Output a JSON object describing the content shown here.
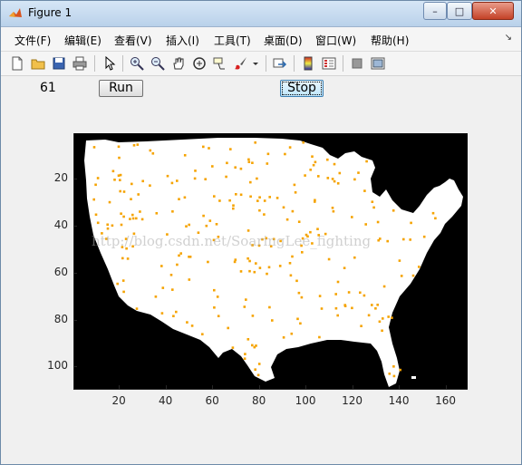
{
  "window": {
    "title": "Figure 1",
    "minimize_glyph": "–",
    "maximize_glyph": "□",
    "close_glyph": "✕"
  },
  "menu": {
    "items": [
      "文件(F)",
      "编辑(E)",
      "查看(V)",
      "插入(I)",
      "工具(T)",
      "桌面(D)",
      "窗口(W)",
      "帮助(H)"
    ],
    "dock_glyph": "↘"
  },
  "toolbar": {
    "icons": [
      "new-figure-icon",
      "open-file-icon",
      "save-icon",
      "print-icon",
      "arrow-pointer-icon",
      "zoom-in-icon",
      "zoom-out-icon",
      "pan-hand-icon",
      "rotate-3d-icon",
      "data-cursor-icon",
      "brush-icon",
      "brush-dropdown-icon",
      "link-plot-icon",
      "colorbar-icon",
      "legend-icon",
      "hide-plot-tools-icon",
      "show-plot-tools-icon"
    ]
  },
  "controls": {
    "counter": "61",
    "run_label": "Run",
    "stop_label": "Stop"
  },
  "watermark": "http://blog.csdn.net/SoaringLee_fighting",
  "colors": {
    "background": "#000000",
    "land": "#ffffff",
    "marker": "#f5a300"
  },
  "chart_data": {
    "type": "heatmap",
    "description_type": "image",
    "xlim": [
      0.5,
      169.5
    ],
    "ylim": [
      0.5,
      109.5
    ],
    "xticks": [
      "20",
      "40",
      "60",
      "80",
      "100",
      "120",
      "140",
      "160"
    ],
    "yticks": [
      "20",
      "40",
      "60",
      "80",
      "100"
    ],
    "xtick_values": [
      20,
      40,
      60,
      80,
      100,
      120,
      140,
      160
    ],
    "ytick_values": [
      20,
      40,
      60,
      80,
      100
    ]
  }
}
